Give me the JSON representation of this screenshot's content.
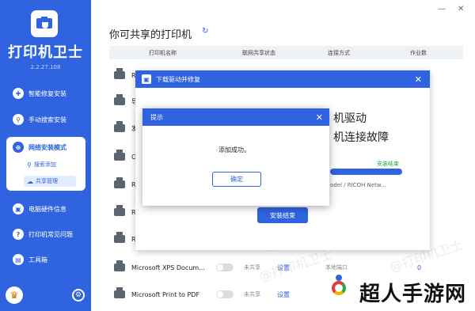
{
  "app": {
    "title": "打印机卫士",
    "version": "2.2.27.108"
  },
  "sidebar": {
    "items": [
      {
        "label": "智能修复安装",
        "icon": "repair-icon"
      },
      {
        "label": "手动搜索安装",
        "icon": "search-icon"
      },
      {
        "label": "网络安装模式",
        "icon": "network-icon"
      },
      {
        "label": "电脑硬件信息",
        "icon": "hardware-icon"
      },
      {
        "label": "打印机常见问题",
        "icon": "question-icon"
      },
      {
        "label": "工具箱",
        "icon": "toolbox-icon"
      }
    ],
    "subitems": [
      {
        "label": "搜索添加",
        "icon": "search-icon"
      },
      {
        "label": "共享管理",
        "icon": "cloud-icon"
      }
    ]
  },
  "main": {
    "title": "你可共享的打印机",
    "headers": [
      "打印机名称",
      "联网共享状态",
      "连接方式",
      "作业数"
    ],
    "rows": [
      {
        "name": "R"
      },
      {
        "name": "导"
      },
      {
        "name": "发"
      },
      {
        "name": "O"
      },
      {
        "name": "R"
      },
      {
        "name": "R"
      },
      {
        "name": "R"
      },
      {
        "name": "Microsoft XPS Docum...",
        "share": "未共享",
        "setting": "设置",
        "port": "本地端口",
        "jobs": "0"
      },
      {
        "name": "Microsoft Print to PDF",
        "share": "未共享",
        "setting": "设置"
      }
    ]
  },
  "dialog_repair": {
    "title": "下载驱动并修复",
    "line1": "机驱动",
    "line2": "机连接故障",
    "state": "安装结束",
    "progress": 1.0,
    "model": "odel / RICOH Netw...",
    "done_button": "安装结束"
  },
  "dialog_tip": {
    "title": "提示",
    "message": "添加成功。",
    "ok_button": "确定"
  },
  "watermark": "@打印机卫士",
  "brand": {
    "text": "超人手游网"
  },
  "window": {
    "minimize": "—",
    "close": "✕"
  }
}
